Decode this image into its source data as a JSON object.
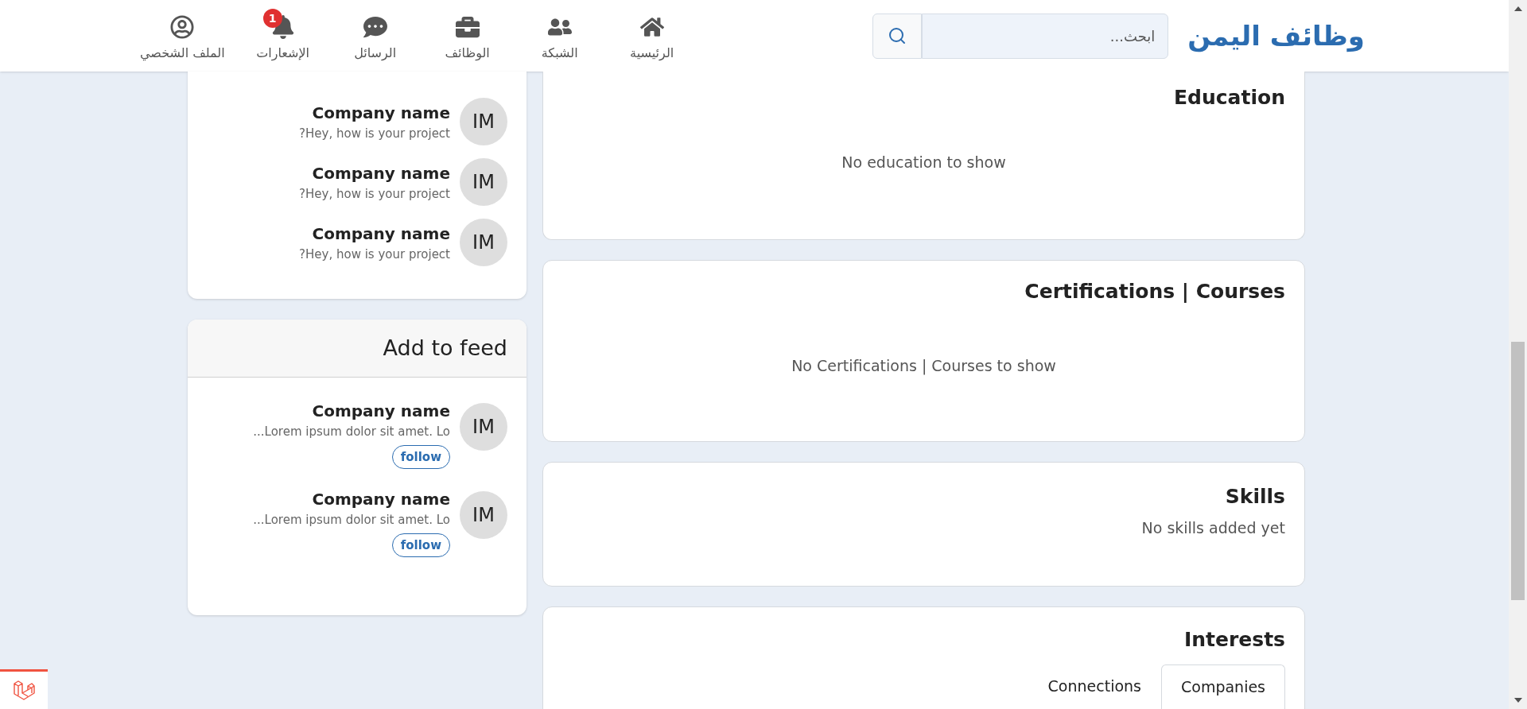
{
  "brand": "وظائف اليمن",
  "search": {
    "placeholder": "ابحث..."
  },
  "nav": [
    {
      "label": "الرئيسية",
      "kind": "home"
    },
    {
      "label": "الشبكة",
      "kind": "network"
    },
    {
      "label": "الوظائف",
      "kind": "jobs"
    },
    {
      "label": "الرسائل",
      "kind": "messages"
    },
    {
      "label": "الإشعارات",
      "kind": "bell",
      "badge": "1"
    },
    {
      "label": "الملف الشخصي",
      "kind": "profile"
    }
  ],
  "messages": {
    "items": [
      {
        "avatar": "IM",
        "name": "Company name",
        "text": "?Hey, how is your project"
      },
      {
        "avatar": "IM",
        "name": "Company name",
        "text": "?Hey, how is your project"
      },
      {
        "avatar": "IM",
        "name": "Company name",
        "text": "?Hey, how is your project"
      }
    ]
  },
  "feed": {
    "title": "Add to feed",
    "items": [
      {
        "avatar": "IM",
        "name": "Company name",
        "text": "...Lorem ipsum dolor sit amet. Lo",
        "button": "follow"
      },
      {
        "avatar": "IM",
        "name": "Company name",
        "text": "...Lorem ipsum dolor sit amet. Lo",
        "button": "follow"
      }
    ]
  },
  "sections": [
    {
      "kind": "centered",
      "title": "Education",
      "empty": "No education to show"
    },
    {
      "kind": "centered",
      "title": "Certifications | Courses",
      "empty": "No Certifications | Courses to show"
    },
    {
      "kind": "inline",
      "title": "Skills",
      "empty": "No skills added yet"
    },
    {
      "kind": "tabs",
      "title": "Interests",
      "tabs": [
        {
          "label": "Connections",
          "selected": false
        },
        {
          "label": "Companies",
          "selected": true
        }
      ]
    }
  ]
}
